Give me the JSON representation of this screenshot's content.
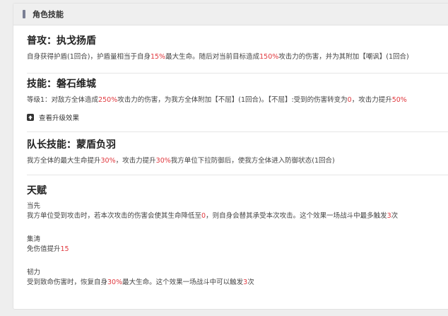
{
  "header": {
    "title": "角色技能"
  },
  "attack": {
    "title": "普攻：执戈扬盾",
    "d1": "自身获得护盾(1回合)，护盾量相当于自身",
    "v1": "15%",
    "d2": "最大生命。随后对当前目标造成",
    "v2": "150%",
    "d3": "攻击力的伤害，并为其附加【嘲讽】(1回合)"
  },
  "skill": {
    "title": "技能：磐石维城",
    "d0": "等级1：",
    "d1": "对敌方全体造成",
    "v1": "250%",
    "d2": "攻击力的伤害，为我方全体附加【不屈】(1回合)。【不屈】:受到的伤害转变为",
    "v2": "0",
    "d3": "，攻击力提升",
    "v3": "50%",
    "upgrade_label": "查看升级效果"
  },
  "leader": {
    "title": "队长技能：蒙盾负羽",
    "d1": "我方全体的最大生命提升",
    "v1": "30%",
    "d2": "，攻击力提升",
    "v2": "30%",
    "d3": "我方单位下拉防御后，使我方全体进入防御状态(1回合)"
  },
  "talents": {
    "title": "天赋",
    "items": [
      {
        "name": "当先",
        "d1": "我方单位受到攻击时，若本次攻击的伤害会使其生命降低至",
        "v1": "0",
        "d2": "，则自身会替其承受本次攻击。这个效果一场战斗中最多触发",
        "v2": "3",
        "d3": "次"
      },
      {
        "name": "集涛",
        "d1": "免伤值提升",
        "v1": "15"
      },
      {
        "name": "韧力",
        "d1": "受到致命伤害时，恢复自身",
        "v1": "30%",
        "d2": "最大生命。这个效果一场战斗中可以触发",
        "v2": "3",
        "d3": "次"
      }
    ]
  },
  "colors": {
    "highlight": "#e0383e",
    "header_bg": "#efefef",
    "accent_bar": "#7a7f94"
  },
  "icons": {
    "upgrade": "arrow-up-box-icon"
  }
}
